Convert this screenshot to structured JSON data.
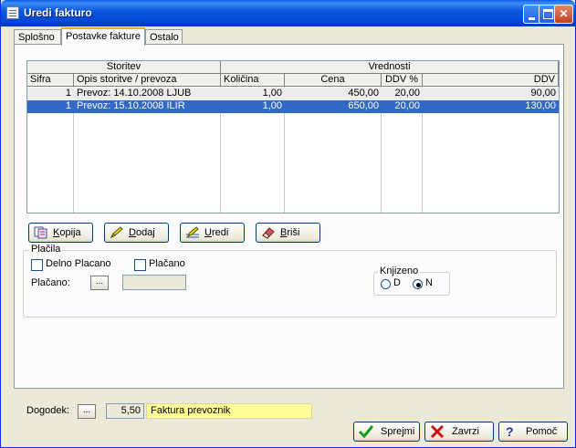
{
  "window": {
    "title": "Uredi fakturo"
  },
  "tabs": [
    {
      "label": "Splošno"
    },
    {
      "label": "Postavke fakture"
    },
    {
      "label": "Ostalo"
    }
  ],
  "grid": {
    "group_headers": {
      "storitev": "Storitev",
      "vrednosti": "Vrednosti"
    },
    "columns": [
      "Sifra",
      "Opis storitve / prevoza",
      "Količina",
      "Cena",
      "DDV %",
      "DDV"
    ],
    "rows": [
      {
        "sifra": "1",
        "opis": "Prevoz: 14.10.2008  LJUB",
        "kolicina": "1,00",
        "cena": "450,00",
        "ddv_pct": "20,00",
        "ddv": "90,00",
        "selected": false
      },
      {
        "sifra": "1",
        "opis": "Prevoz: 15.10.2008  ILIR",
        "kolicina": "1,00",
        "cena": "650,00",
        "ddv_pct": "20,00",
        "ddv": "130,00",
        "selected": true
      }
    ]
  },
  "actions": {
    "kopija": {
      "key": "K",
      "rest": "opija"
    },
    "dodaj": {
      "key": "D",
      "rest": "odaj"
    },
    "uredi": {
      "key": "U",
      "rest": "redi"
    },
    "brisi": {
      "key": "B",
      "rest": "riši"
    }
  },
  "placila": {
    "title": "Plačila",
    "delno_placano": "Delno Placano",
    "placano_chk": "Plačano",
    "placano_label": "Plačano:",
    "ellipsis": "...",
    "placano_value": ""
  },
  "knjizeno": {
    "title": "Knjizeno",
    "option_d": "D",
    "option_n": "N",
    "selected": "N"
  },
  "dogodek": {
    "label": "Dogodek:",
    "ellipsis": "...",
    "code": "5,50",
    "text": "Faktura prevoznik"
  },
  "footer": {
    "sprejmi": "Sprejmi",
    "zavrzi": "Zavrzi",
    "pomoc": "Pomoč"
  },
  "colors": {
    "titlebar": "#0a5ae0",
    "selection": "#3169c6",
    "highlight_field": "#ffff99"
  }
}
